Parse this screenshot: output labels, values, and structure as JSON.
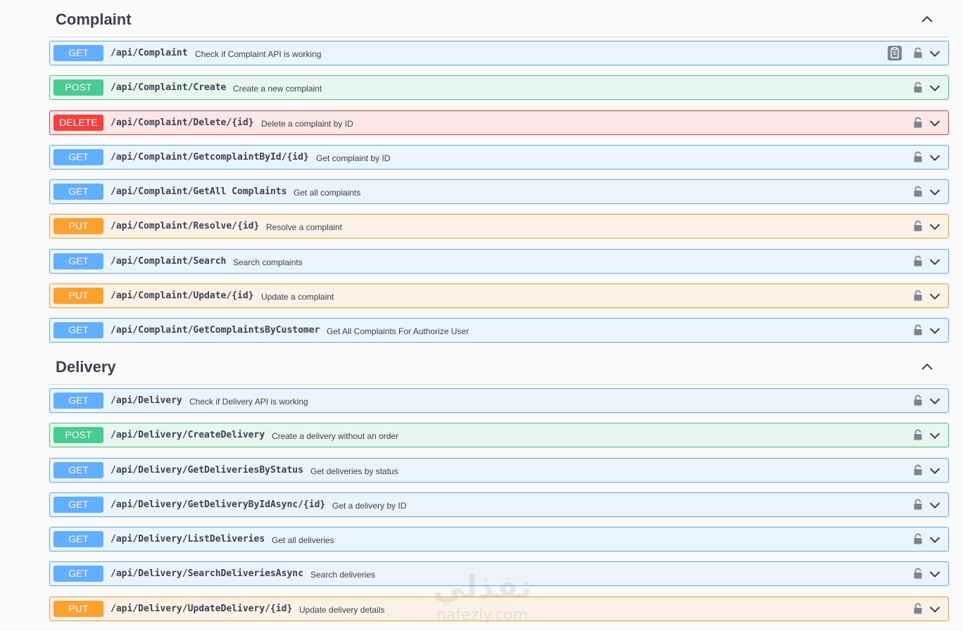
{
  "sections": [
    {
      "title": "Complaint",
      "endpoints": [
        {
          "method": "GET",
          "path": "/api/Complaint",
          "desc": "Check if Complaint API is working",
          "copy": true
        },
        {
          "method": "POST",
          "path": "/api/Complaint/Create",
          "desc": "Create a new complaint"
        },
        {
          "method": "DELETE",
          "path": "/api/Complaint/Delete/{id}",
          "desc": "Delete a complaint by ID"
        },
        {
          "method": "GET",
          "path": "/api/Complaint/GetcomplaintById/{id}",
          "desc": "Get complaint by ID"
        },
        {
          "method": "GET",
          "path": "/api/Complaint/GetAll Complaints",
          "desc": "Get all complaints"
        },
        {
          "method": "PUT",
          "path": "/api/Complaint/Resolve/{id}",
          "desc": "Resolve a complaint"
        },
        {
          "method": "GET",
          "path": "/api/Complaint/Search",
          "desc": "Search complaints"
        },
        {
          "method": "PUT",
          "path": "/api/Complaint/Update/{id}",
          "desc": "Update a complaint"
        },
        {
          "method": "GET",
          "path": "/api/Complaint/GetComplaintsByCustomer",
          "desc": "Get All Complaints For Authorize User"
        }
      ]
    },
    {
      "title": "Delivery",
      "endpoints": [
        {
          "method": "GET",
          "path": "/api/Delivery",
          "desc": "Check if Delivery API is working"
        },
        {
          "method": "POST",
          "path": "/api/Delivery/CreateDelivery",
          "desc": "Create a delivery without an order"
        },
        {
          "method": "GET",
          "path": "/api/Delivery/GetDeliveriesByStatus",
          "desc": "Get deliveries by status"
        },
        {
          "method": "GET",
          "path": "/api/Delivery/GetDeliveryByIdAsync/{id}",
          "desc": "Get a delivery by ID"
        },
        {
          "method": "GET",
          "path": "/api/Delivery/ListDeliveries",
          "desc": "Get all deliveries"
        },
        {
          "method": "GET",
          "path": "/api/Delivery/SearchDeliveriesAsync",
          "desc": "Search deliveries"
        },
        {
          "method": "PUT",
          "path": "/api/Delivery/UpdateDelivery/{id}",
          "desc": "Update delivery details"
        }
      ]
    }
  ],
  "watermark": {
    "arabic": "نفذلي",
    "latin": "nafezly.com"
  },
  "colors": {
    "get": "#61affe",
    "post": "#49cc90",
    "delete": "#f93e3e",
    "put": "#fca130",
    "text": "#3b4151"
  },
  "icons": {
    "lock": "lock-icon",
    "expand": "chevron-down-icon",
    "collapse": "chevron-up-icon",
    "copy": "copy-icon"
  }
}
